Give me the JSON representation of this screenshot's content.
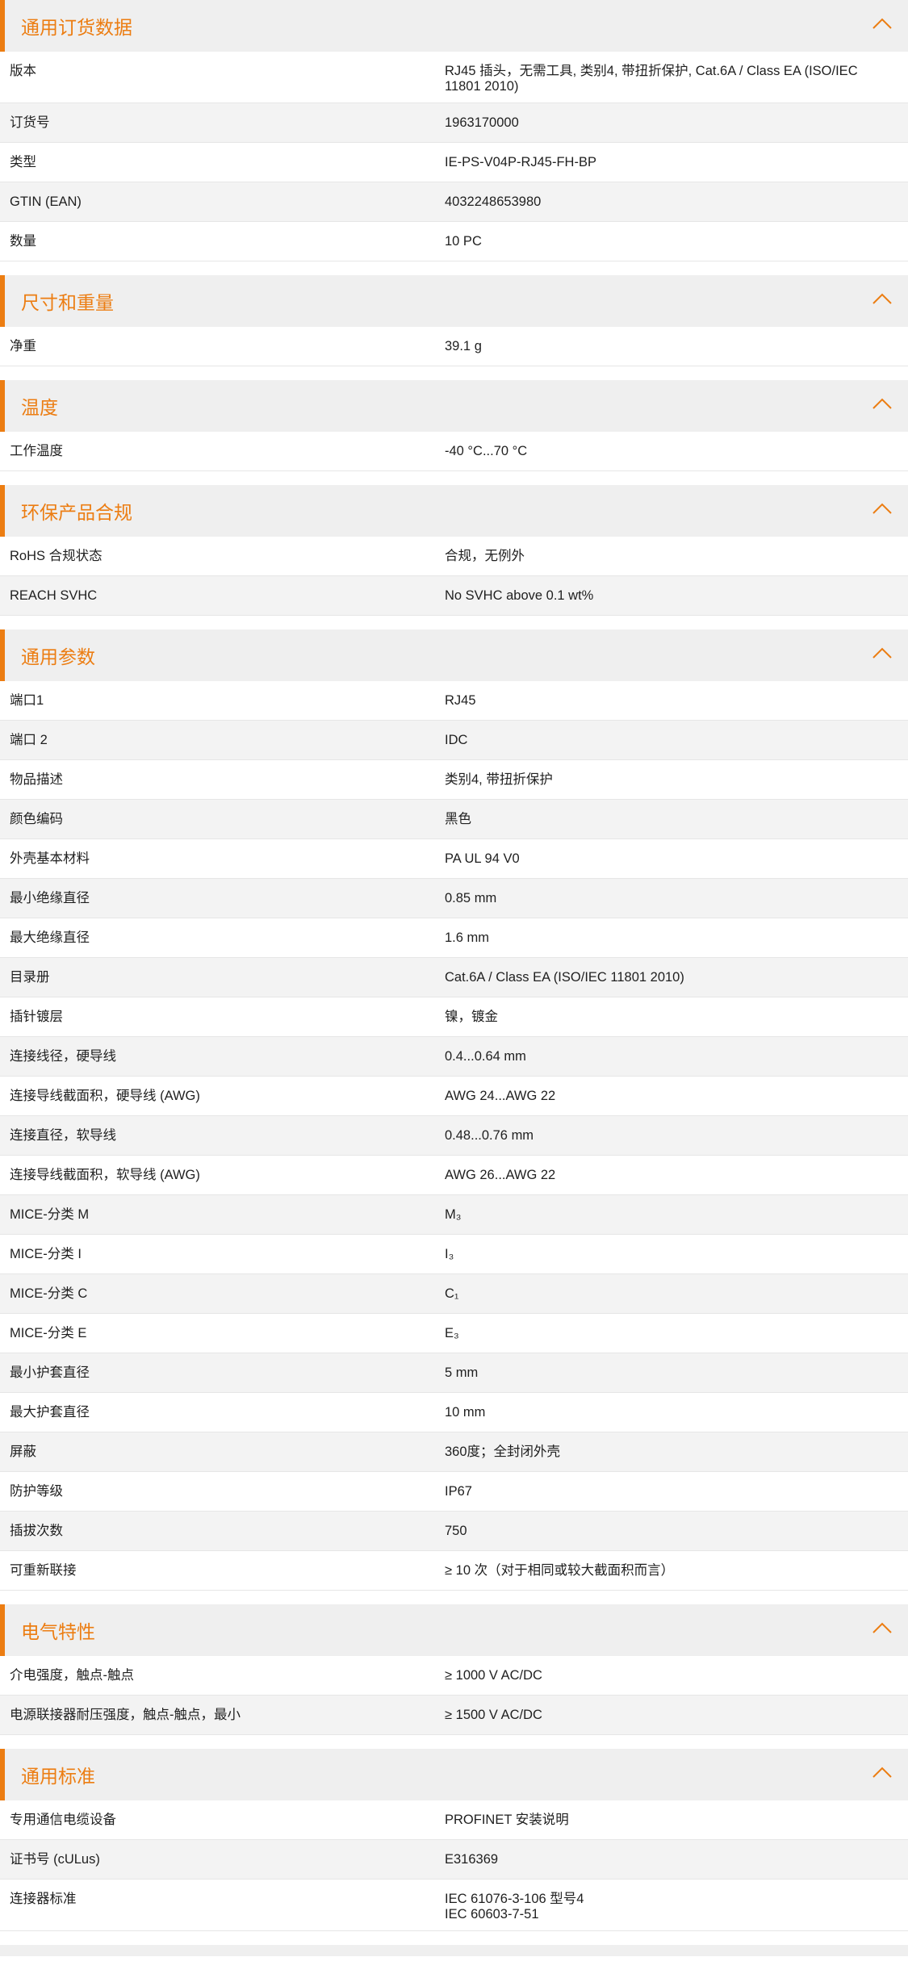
{
  "theme": {
    "accent": "#ec7d12",
    "header_bg": "#efefef",
    "alt_row_bg": "#f3f3f3"
  },
  "sections": [
    {
      "title": "通用订货数据",
      "icon": "chevron-up-icon",
      "rows": [
        {
          "label": "版本",
          "value": [
            "RJ45 插头，无需工具, 类别4, 带扭折保护, Cat.6A / Class EA (ISO/IEC 11801 2010)"
          ]
        },
        {
          "label": "订货号",
          "value": [
            "1963170000"
          ]
        },
        {
          "label": "类型",
          "value": [
            "IE-PS-V04P-RJ45-FH-BP"
          ]
        },
        {
          "label": "GTIN (EAN)",
          "value": [
            "4032248653980"
          ]
        },
        {
          "label": "数量",
          "value": [
            "10  PC"
          ]
        }
      ]
    },
    {
      "title": "尺寸和重量",
      "icon": "chevron-up-icon",
      "rows": [
        {
          "label": "净重",
          "value": [
            "39.1  g"
          ]
        }
      ]
    },
    {
      "title": "温度",
      "icon": "chevron-up-icon",
      "rows": [
        {
          "label": "工作温度",
          "value": [
            "-40 °C...70 °C"
          ]
        }
      ]
    },
    {
      "title": "环保产品合规",
      "icon": "chevron-up-icon",
      "rows": [
        {
          "label": "RoHS 合规状态",
          "value": [
            "合规，无例外"
          ]
        },
        {
          "label": "REACH SVHC",
          "value": [
            "No SVHC above 0.1 wt%"
          ]
        }
      ]
    },
    {
      "title": "通用参数",
      "icon": "chevron-up-icon",
      "rows": [
        {
          "label": "端口1",
          "value": [
            "RJ45"
          ]
        },
        {
          "label": "端口 2",
          "value": [
            "IDC"
          ]
        },
        {
          "label": "物品描述",
          "value": [
            "类别4, 带扭折保护"
          ]
        },
        {
          "label": "颜色编码",
          "value": [
            "黑色"
          ]
        },
        {
          "label": "外壳基本材料",
          "value": [
            "PA UL 94 V0"
          ]
        },
        {
          "label": "最小绝缘直径",
          "value": [
            "0.85  mm"
          ]
        },
        {
          "label": "最大绝缘直径",
          "value": [
            "1.6  mm"
          ]
        },
        {
          "label": "目录册",
          "value": [
            "Cat.6A / Class EA (ISO/IEC 11801 2010)"
          ]
        },
        {
          "label": "插针镀层",
          "value": [
            "镍，镀金"
          ]
        },
        {
          "label": "连接线径，硬导线",
          "value": [
            "0.4...0.64 mm"
          ]
        },
        {
          "label": "连接导线截面积，硬导线 (AWG)",
          "value": [
            "AWG 24...AWG 22"
          ]
        },
        {
          "label": "连接直径，软导线",
          "value": [
            "0.48...0.76 mm"
          ]
        },
        {
          "label": "连接导线截面积，软导线 (AWG)",
          "value": [
            "AWG 26...AWG 22"
          ]
        },
        {
          "label": "MICE-分类 M",
          "value": [
            "M₃"
          ]
        },
        {
          "label": "MICE-分类 I",
          "value": [
            "I₃"
          ]
        },
        {
          "label": "MICE-分类 C",
          "value": [
            "C₁"
          ]
        },
        {
          "label": "MICE-分类 E",
          "value": [
            "E₃"
          ]
        },
        {
          "label": "最小护套直径",
          "value": [
            "5  mm"
          ]
        },
        {
          "label": "最大护套直径",
          "value": [
            "10  mm"
          ]
        },
        {
          "label": "屏蔽",
          "value": [
            "360度；全封闭外壳"
          ]
        },
        {
          "label": "防护等级",
          "value": [
            "IP67"
          ]
        },
        {
          "label": "插拔次数",
          "value": [
            "750"
          ]
        },
        {
          "label": "可重新联接",
          "value": [
            "≥ 10 次（对于相同或较大截面积而言）"
          ]
        }
      ]
    },
    {
      "title": "电气特性",
      "icon": "chevron-up-icon",
      "rows": [
        {
          "label": "介电强度，触点-触点",
          "value": [
            "≥ 1000 V AC/DC"
          ]
        },
        {
          "label": "电源联接器耐压强度，触点-触点，最小",
          "value": [
            "≥ 1500 V AC/DC"
          ]
        }
      ]
    },
    {
      "title": "通用标准",
      "icon": "chevron-up-icon",
      "rows": [
        {
          "label": "专用通信电缆设备",
          "value": [
            "PROFINET 安装说明"
          ]
        },
        {
          "label": "证书号 (cULus)",
          "value": [
            "E316369"
          ]
        },
        {
          "label": "连接器标准",
          "value": [
            "IEC 61076-3-106 型号4",
            "IEC 60603-7-51"
          ]
        }
      ]
    }
  ]
}
